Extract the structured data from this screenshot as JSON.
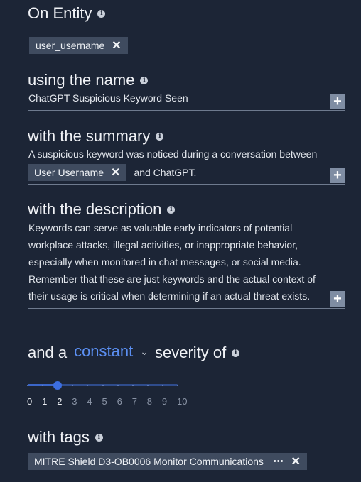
{
  "entity": {
    "heading": "On Entity",
    "chip": "user_username"
  },
  "name": {
    "heading": "using the name",
    "value": "ChatGPT Suspicious Keyword Seen",
    "add_label": "+"
  },
  "summary": {
    "heading": "with the summary",
    "line1": "A suspicious keyword was noticed during a conversation between",
    "chip": "User Username",
    "line2_tail": "and ChatGPT.",
    "add_label": "+"
  },
  "description": {
    "heading": "with the description",
    "lines": [
      "Keywords can serve as valuable early indicators of potential",
      "workplace attacks, illegal activities, or inappropriate behavior,",
      "especially when monitored in chat messages, or social media.",
      "Remember that these are just keywords and the actual context of",
      "their usage is critical when determining if an actual threat exists."
    ],
    "add_label": "+"
  },
  "severity": {
    "prefix": "and a",
    "mode": "constant",
    "suffix": "severity of",
    "value": 2,
    "min": 0,
    "max": 10,
    "scale": [
      "0",
      "1",
      "2",
      "3",
      "4",
      "5",
      "6",
      "7",
      "8",
      "9",
      "10"
    ]
  },
  "tags": {
    "heading": "with tags",
    "chip": "MITRE Shield D3-OB0006 Monitor Communications",
    "more": "•••"
  },
  "colors": {
    "background": "#1c2536",
    "accent": "#3c6ee0",
    "chip": "#3f4b5f"
  }
}
